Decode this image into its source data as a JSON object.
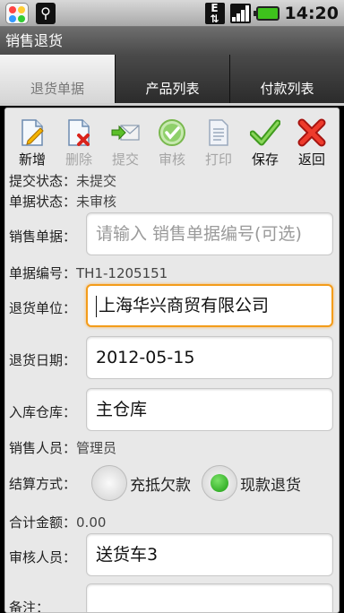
{
  "status_bar": {
    "network_type": "E",
    "time": "14:20"
  },
  "title": "销售退货",
  "tabs": [
    {
      "label": "退货单据"
    },
    {
      "label": "产品列表"
    },
    {
      "label": "付款列表"
    }
  ],
  "toolbar": [
    {
      "label": "新增",
      "icon": "new-document-icon",
      "enabled": true
    },
    {
      "label": "删除",
      "icon": "delete-document-icon",
      "enabled": false
    },
    {
      "label": "提交",
      "icon": "submit-envelope-icon",
      "enabled": false
    },
    {
      "label": "审核",
      "icon": "audit-check-icon",
      "enabled": false
    },
    {
      "label": "打印",
      "icon": "print-document-icon",
      "enabled": false
    },
    {
      "label": "保存",
      "icon": "save-check-icon",
      "enabled": true
    },
    {
      "label": "返回",
      "icon": "back-cross-icon",
      "enabled": true
    }
  ],
  "form": {
    "submit_status_label": "提交状态：",
    "submit_status_value": "未提交",
    "doc_status_label": "单据状态：",
    "doc_status_value": "未审核",
    "sales_doc_label": "销售单据：",
    "sales_doc_placeholder": "请输入 销售单据编号(可选)",
    "doc_no_label": "单据编号：",
    "doc_no_value": "TH1-1205151",
    "return_unit_label": "退货单位：",
    "return_unit_value": "上海华兴商贸有限公司",
    "return_date_label": "退货日期：",
    "return_date_value": "2012-05-15",
    "warehouse_label": "入库仓库：",
    "warehouse_value": "主仓库",
    "salesperson_label": "销售人员：",
    "salesperson_value": "管理员",
    "settlement_label": "结算方式：",
    "settlement_options": [
      {
        "label": "充抵欠款",
        "selected": false
      },
      {
        "label": "现款退货",
        "selected": true
      }
    ],
    "total_label": "合计金额：",
    "total_value": "0.00",
    "auditor_label": "审核人员：",
    "auditor_value": "送货车3",
    "remark_label": "备注："
  }
}
